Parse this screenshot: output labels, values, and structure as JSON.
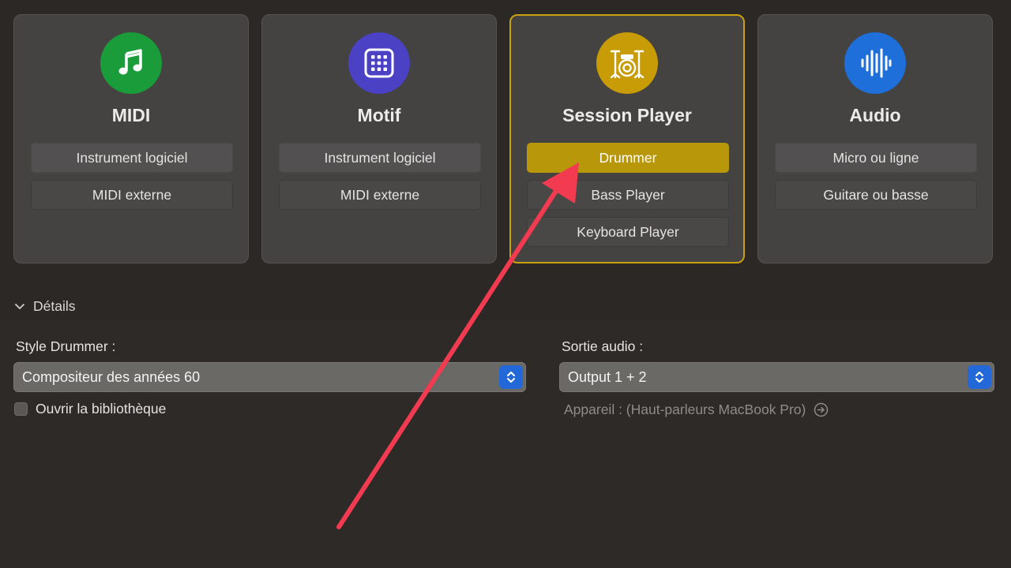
{
  "cards": [
    {
      "title": "MIDI",
      "icon": "music-note-icon",
      "icon_color": "#1a9c3a",
      "options": [
        "Instrument logiciel",
        "MIDI externe"
      ]
    },
    {
      "title": "Motif",
      "icon": "grid-pattern-icon",
      "icon_color": "#4b41c4",
      "options": [
        "Instrument logiciel",
        "MIDI externe"
      ]
    },
    {
      "title": "Session Player",
      "icon": "drum-kit-icon",
      "icon_color": "#c79c06",
      "selected": true,
      "options": [
        "Drummer",
        "Bass Player",
        "Keyboard Player"
      ],
      "active_option": "Drummer"
    },
    {
      "title": "Audio",
      "icon": "waveform-icon",
      "icon_color": "#1e6fd9",
      "options": [
        "Micro ou ligne",
        "Guitare ou basse"
      ]
    }
  ],
  "details": {
    "label": "Détails",
    "expanded": true
  },
  "style": {
    "label": "Style Drummer :",
    "value": "Compositeur des années 60"
  },
  "library": {
    "label": "Ouvrir la bibliothèque",
    "checked": false
  },
  "output": {
    "label": "Sortie audio :",
    "value": "Output 1 + 2",
    "device": "Appareil : (Haut-parleurs MacBook Pro)"
  },
  "colors": {
    "accent": "#c9a10f",
    "stepper": "#2368d8",
    "annotation_arrow": "#f23a50"
  }
}
